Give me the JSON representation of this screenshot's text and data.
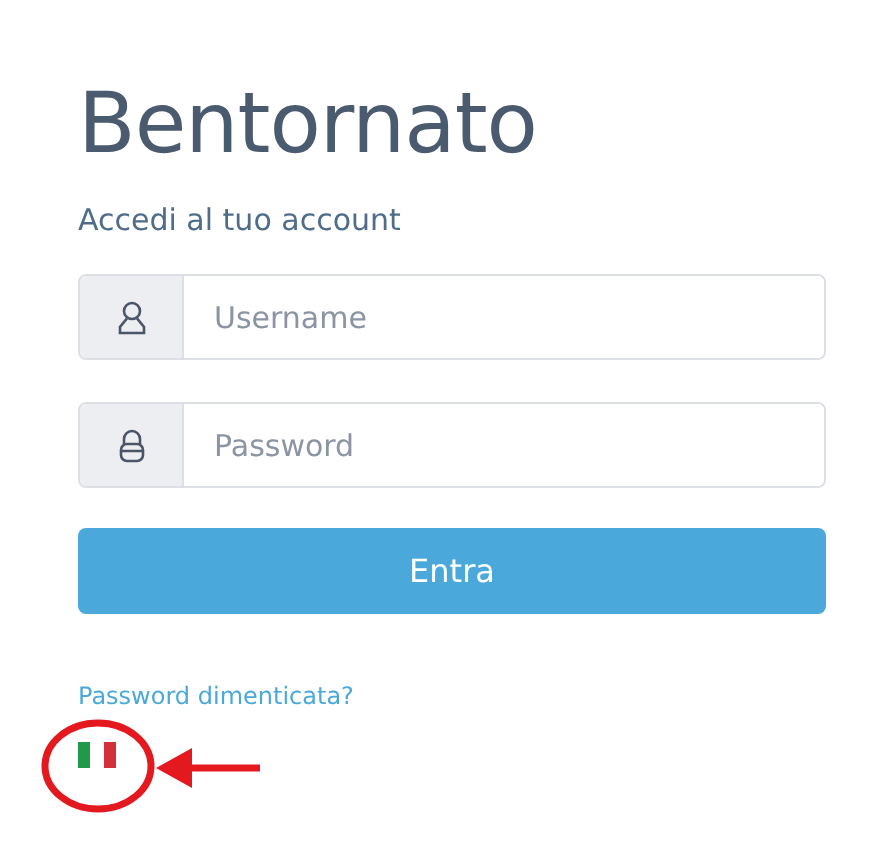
{
  "title": "Bentornato",
  "subtitle": "Accedi al tuo account",
  "fields": [
    {
      "kind": "user",
      "placeholder": "Username"
    },
    {
      "kind": "lock",
      "placeholder": "Password"
    }
  ],
  "submit": "Entra",
  "forgot_link": "Password dimenticata?"
}
